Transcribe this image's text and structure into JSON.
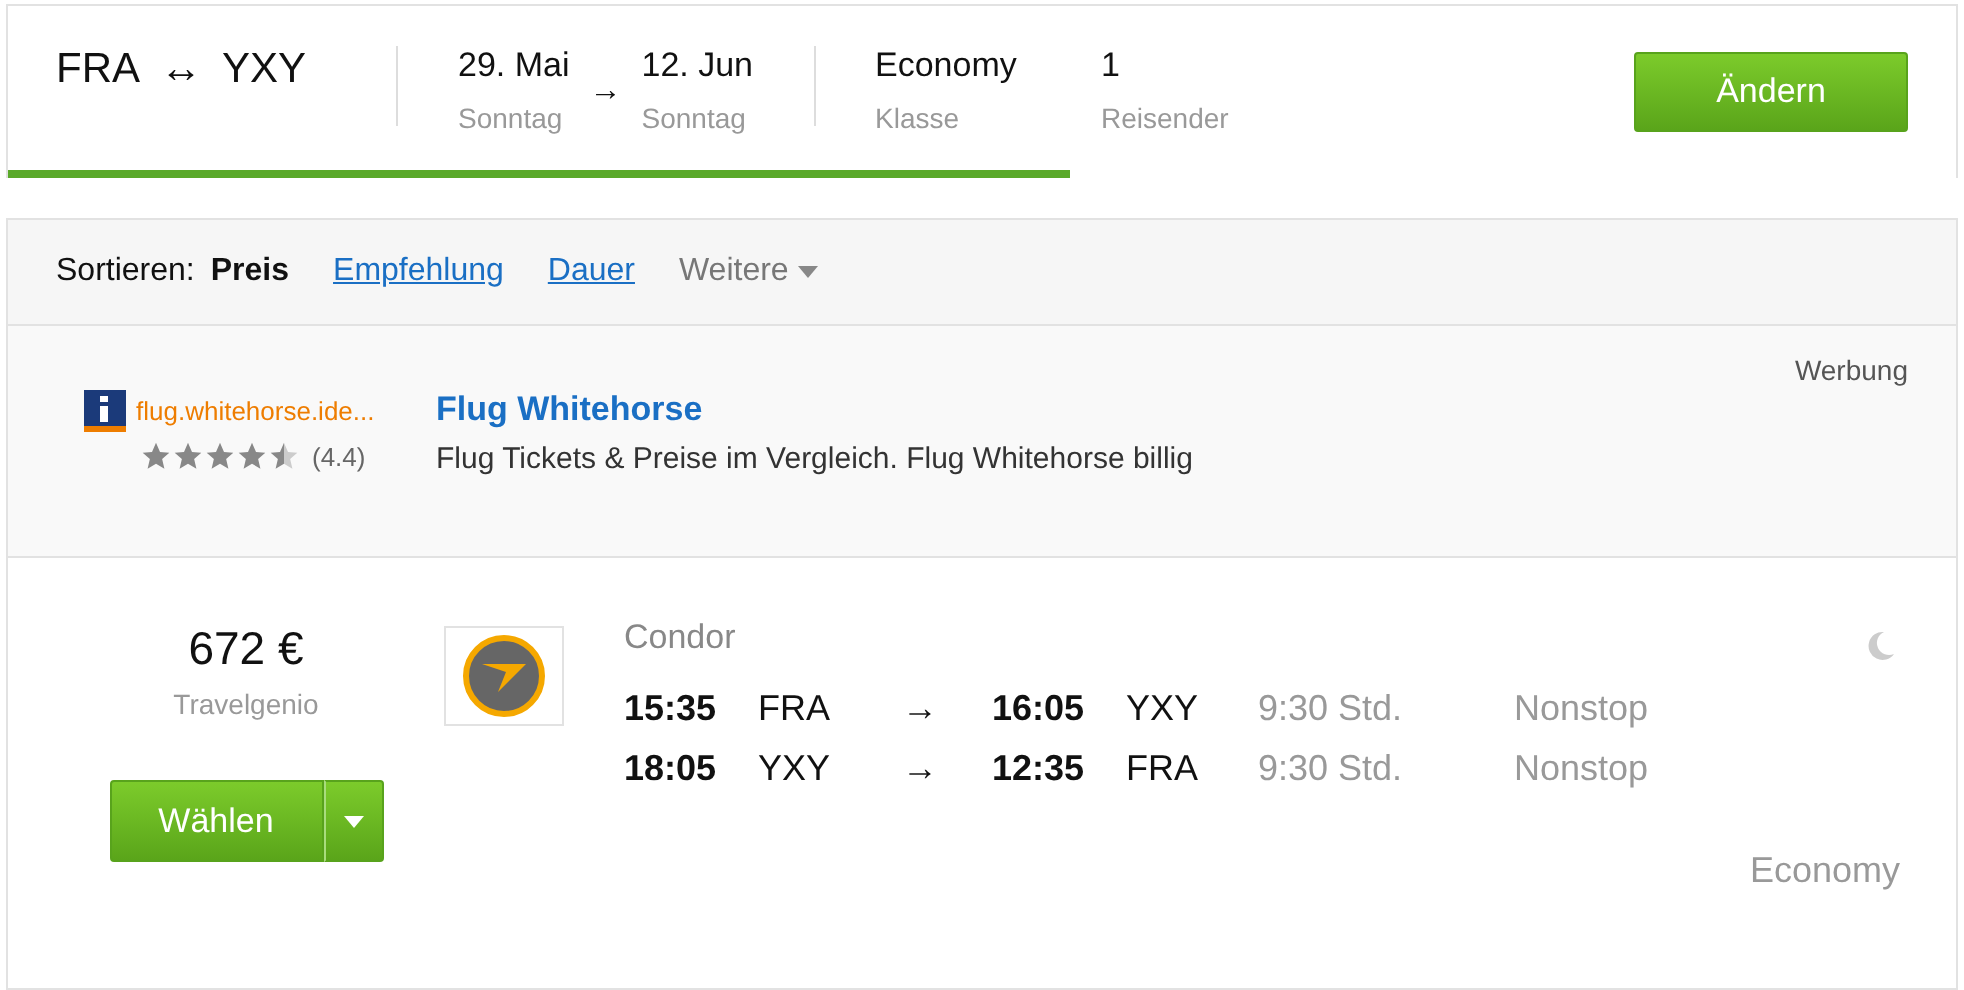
{
  "search": {
    "origin": "FRA",
    "route_symbol": "↔",
    "destination": "YXY",
    "depart_date": "29. Mai",
    "depart_day": "Sonntag",
    "date_arrow": "→",
    "return_date": "12. Jun",
    "return_day": "Sonntag",
    "cabin": "Economy",
    "cabin_label": "Klasse",
    "travelers": "1",
    "travelers_label": "Reisender",
    "change_button": "Ändern",
    "progress": {
      "level": 0.545
    }
  },
  "sort": {
    "label": "Sortieren:",
    "options": [
      {
        "label": "Preis",
        "selected": true,
        "kind": "option"
      },
      {
        "label": "Empfehlung",
        "selected": false,
        "kind": "option"
      },
      {
        "label": "Dauer",
        "selected": false,
        "kind": "option"
      },
      {
        "label": "Weitere",
        "selected": false,
        "kind": "menu"
      }
    ]
  },
  "ad": {
    "badge": "Werbung",
    "domain": "flug.whitehorse.ide...",
    "stars": 4.5,
    "rating": "(4.4)",
    "title": "Flug Whitehorse",
    "text": "Flug Tickets & Preise im Vergleich. Flug Whitehorse billig"
  },
  "result": {
    "price": "672 €",
    "provider": "Travelgenio",
    "select_button": "Wählen",
    "airline": "Condor",
    "cabin": "Economy",
    "legs": [
      {
        "dep_time": "15:35",
        "dep_airport": "FRA",
        "arrow": "→",
        "arr_time": "16:05",
        "arr_airport": "YXY",
        "duration": "9:30 Std.",
        "stops": "Nonstop"
      },
      {
        "dep_time": "18:05",
        "dep_airport": "YXY",
        "arrow": "→",
        "arr_time": "12:35",
        "arr_airport": "FRA",
        "duration": "9:30 Std.",
        "stops": "Nonstop"
      }
    ]
  }
}
